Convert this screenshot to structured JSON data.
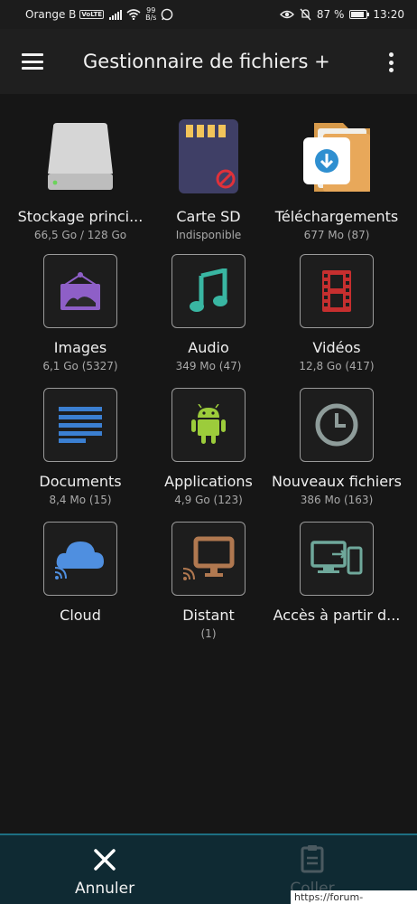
{
  "status_bar": {
    "carrier": "Orange B",
    "volte": "VoLTE",
    "speed_value": "99",
    "speed_unit": "B/s",
    "battery": "87 %",
    "time": "13:20"
  },
  "app_bar": {
    "title": "Gestionnaire de fichiers +"
  },
  "tiles": [
    {
      "label": "Stockage princi...",
      "sub": "66,5 Go / 128 Go",
      "icon": "hard-drive-icon"
    },
    {
      "label": "Carte SD",
      "sub": "Indisponible",
      "icon": "sd-card-icon"
    },
    {
      "label": "Téléchargements",
      "sub": "677 Mo (87)",
      "icon": "downloads-folder-icon"
    },
    {
      "label": "Images",
      "sub": "6,1 Go (5327)",
      "icon": "image-icon"
    },
    {
      "label": "Audio",
      "sub": "349 Mo (47)",
      "icon": "music-note-icon"
    },
    {
      "label": "Vidéos",
      "sub": "12,8 Go (417)",
      "icon": "film-icon"
    },
    {
      "label": "Documents",
      "sub": "8,4 Mo (15)",
      "icon": "document-icon"
    },
    {
      "label": "Applications",
      "sub": "4,9 Go (123)",
      "icon": "android-icon"
    },
    {
      "label": "Nouveaux fichiers",
      "sub": "386 Mo (163)",
      "icon": "clock-icon"
    },
    {
      "label": "Cloud",
      "sub": "",
      "icon": "cloud-icon"
    },
    {
      "label": "Distant",
      "sub": "(1)",
      "icon": "remote-monitor-icon"
    },
    {
      "label": "Accès à partir d...",
      "sub": "",
      "icon": "device-transfer-icon"
    }
  ],
  "bottom_bar": {
    "cancel_label": "Annuler",
    "paste_label": "Coller"
  },
  "watermark": "https://forum-huawei.com",
  "colors": {
    "background": "#161616",
    "bottom_bar": "#0f2a33",
    "accent": "#1d6f82"
  }
}
